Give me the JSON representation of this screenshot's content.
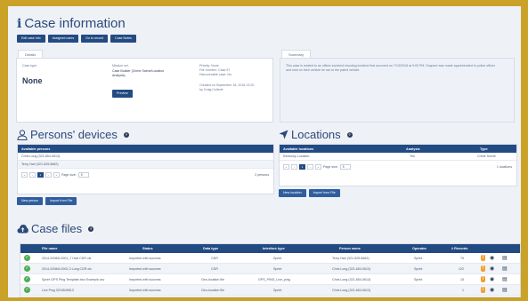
{
  "case": {
    "title": "Case information",
    "buttons": [
      "Edit case info",
      "Assigned users",
      "Go to record",
      "Case Notes"
    ],
    "tabs": {
      "details": "Details",
      "summary": "Summary"
    },
    "case_type_label": "Case type",
    "case_type_value": "None",
    "mission_label": "Mission sel.",
    "mission_value": "Case Builder (Crime Scene/Location Analysis)",
    "preview_label": "Preview",
    "priority": "Priority: None",
    "file_number": "File number: Case 57",
    "discoverable": "Discoverable case: No",
    "created": "Created on September 18, 2018 13:20",
    "created_by": "by Craig Cullerle",
    "summary_text": "This case is related to an officer-involved shooting incident that occurred on 7/13/2018 at 9:00 PM. Suspect was made apprehended to police officer and shot on their vehicle he ran to the patrol vehicle."
  },
  "persons": {
    "title": "Persons' devices",
    "header": "Available persons",
    "rows": [
      "Chris Long (321-654-0613)",
      "Terry Hart (321-525-6662)"
    ],
    "page_size_label": "Page size:",
    "page_size": "5",
    "page": "1",
    "count": "2 persons",
    "buttons": [
      "New person",
      "Import from File"
    ]
  },
  "locations": {
    "title": "Locations",
    "headers": [
      "Available locations",
      "Analysis",
      "Type"
    ],
    "rows": [
      [
        "Kentucky Location",
        "Yes",
        "Crime Scene"
      ]
    ],
    "page_size_label": "Page size:",
    "page_size": "5",
    "page": "1",
    "count": "1 locations",
    "buttons": [
      "New location",
      "Import from File"
    ]
  },
  "files": {
    "title": "Case files",
    "headers": [
      "File name",
      "Status",
      "Data type",
      "Interface type",
      "Person name",
      "Operator",
      "# Records"
    ],
    "rows": [
      [
        "2014-2/0/8/6-0001_7 Hart CDR.xls",
        "Imported with success",
        "CDR",
        "Sprint",
        "Terry Hart (321-525-6662)",
        "Sprint",
        "79"
      ],
      [
        "2014-2/0/8/6-0002-3 Long CDR.xls",
        "Imported with success",
        "CDR",
        "Sprint",
        "Chris Long (321-654-0613)",
        "Sprint",
        "122"
      ],
      [
        "Sprint GPS Ping Template.xlsx Example.csv",
        "Imported with success",
        "Geo-location file",
        "GPS_PING_Live_ping",
        "Chris Long (321-654-0613)",
        "Sprint",
        "15"
      ],
      [
        "Live Ping 3216549613",
        "Imported with success",
        "Geo-location file",
        "Sprint",
        "Chris Long (321-654-0613)",
        "",
        "1"
      ]
    ]
  },
  "colors": {
    "accent": "#234b83",
    "frame": "#c9a227",
    "ok": "#4caf50",
    "warn": "#f0a030"
  }
}
